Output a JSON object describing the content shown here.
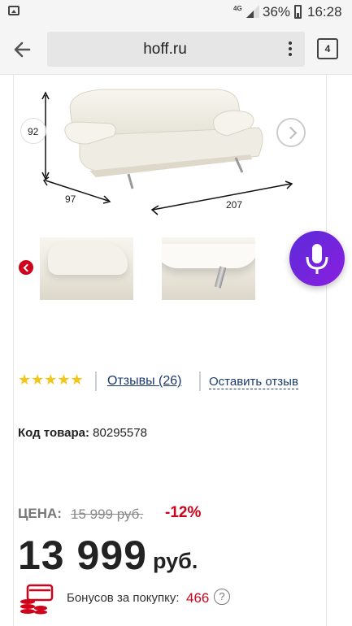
{
  "status_bar": {
    "network": "4G",
    "battery": "36%",
    "time": "16:28"
  },
  "browser": {
    "url": "hoff.ru",
    "tab_count": "4"
  },
  "product": {
    "dimensions": {
      "height": "92",
      "depth": "97",
      "width": "207"
    },
    "reviews_link": "Отзывы (26)",
    "leave_review": "Оставить отзыв",
    "rating_stars": 5,
    "sku_label": "Код товара:",
    "sku_value": "80295578",
    "price_label": "ЦЕНА:",
    "old_price": "15 999 руб.",
    "discount": "-12%",
    "price": "13 999",
    "currency": "руб.",
    "bonus_label": "Бонусов за покупку:",
    "bonus_value": "466",
    "help": "?"
  },
  "colors": {
    "accent_red": "#d0021b",
    "link": "#1b3a6b",
    "star": "#f5c518",
    "mic": "#6d25dc"
  },
  "icons": [
    "gallery-icon",
    "signal-icon",
    "battery-icon",
    "back-arrow-icon",
    "menu-dots-icon",
    "tabs-icon",
    "chevron-left-icon",
    "chevron-right-icon",
    "microphone-icon",
    "bonus-wallet-icon",
    "help-icon"
  ]
}
